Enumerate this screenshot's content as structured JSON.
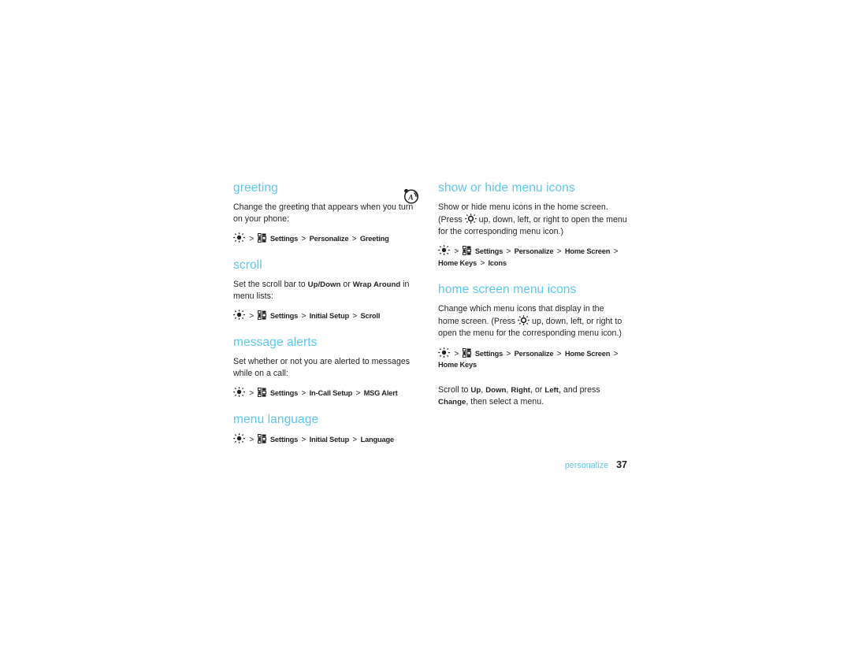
{
  "document": {
    "footer": {
      "chapter": "personalize",
      "page_number": "37"
    },
    "margin_icon": "text-alert-icon"
  },
  "left_column": {
    "sections": [
      {
        "id": "greeting",
        "title": "greeting",
        "body": "Change the greeting that appears when you turn on your phone:",
        "path": {
          "icons": [
            "center-select-key-icon",
            "main-menu-icon"
          ],
          "items": [
            "Settings",
            "Personalize",
            "Greeting"
          ]
        }
      },
      {
        "id": "scroll",
        "title": "scroll",
        "body_parts": [
          {
            "text": "Set the scroll bar to ",
            "bold": false
          },
          {
            "text": "Up/Down",
            "bold": true
          },
          {
            "text": " or ",
            "bold": false
          },
          {
            "text": "Wrap Around",
            "bold": true
          },
          {
            "text": " in menu lists:",
            "bold": false
          }
        ],
        "path": {
          "icons": [
            "center-select-key-icon",
            "main-menu-icon"
          ],
          "items": [
            "Settings",
            "Initial Setup",
            "Scroll"
          ]
        }
      },
      {
        "id": "message-alerts",
        "title": "message alerts",
        "body": "Set whether or not you are alerted to messages while on a call:",
        "path": {
          "icons": [
            "center-select-key-icon",
            "main-menu-icon"
          ],
          "items": [
            "Settings",
            "In-Call Setup",
            "MSG Alert"
          ]
        }
      },
      {
        "id": "menu-language",
        "title": "menu language",
        "path": {
          "icons": [
            "center-select-key-icon",
            "main-menu-icon"
          ],
          "items": [
            "Settings",
            "Initial Setup",
            "Language"
          ]
        }
      }
    ]
  },
  "right_column": {
    "sections": [
      {
        "id": "show-or-hide-menu-icons",
        "title": "show or hide menu icons",
        "body_line1": "Show or hide menu icons in the home screen.",
        "body_before_icon": "(Press ",
        "body_after_icon": " up, down, left, or right to open the menu for the corresponding menu icon.)",
        "nav_icon": "nav-key-icon",
        "path": {
          "icons": [
            "center-select-key-icon",
            "main-menu-icon"
          ],
          "items": [
            "Settings",
            "Personalize",
            "Home Screen",
            "Home Keys",
            "Icons"
          ]
        }
      },
      {
        "id": "home-screen-menu-icons",
        "title": "home screen menu icons",
        "body_before_icon": "Change which menu icons that display in the home screen. (Press ",
        "body_after_icon": " up, down, left, or right to open the menu for the corresponding menu icon.)",
        "nav_icon": "nav-key-icon",
        "path": {
          "icons": [
            "center-select-key-icon",
            "main-menu-icon"
          ],
          "items": [
            "Settings",
            "Personalize",
            "Home Screen",
            "Home Keys"
          ]
        },
        "trailer_parts": [
          {
            "text": "Scroll to ",
            "bold": false
          },
          {
            "text": "Up",
            "bold": true
          },
          {
            "text": ", ",
            "bold": false
          },
          {
            "text": "Down",
            "bold": true
          },
          {
            "text": ", ",
            "bold": false
          },
          {
            "text": "Right",
            "bold": true
          },
          {
            "text": ", or ",
            "bold": false
          },
          {
            "text": "Left",
            "bold": true
          },
          {
            "text": ", and press ",
            "bold": false
          },
          {
            "text": "Change",
            "bold": true
          },
          {
            "text": ", then select a menu.",
            "bold": false
          }
        ]
      }
    ]
  },
  "colors": {
    "heading": "#5bc6ee",
    "body": "#231f20",
    "page_background": "#ffffff"
  }
}
